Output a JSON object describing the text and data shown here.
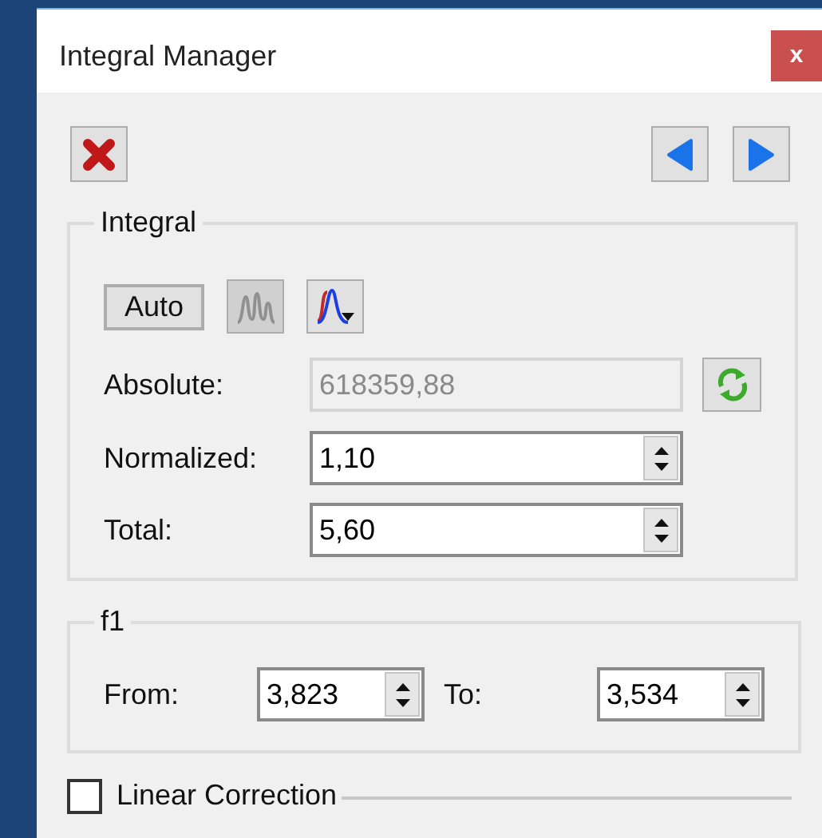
{
  "window": {
    "title": "Integral Manager",
    "close_label": "x"
  },
  "integral": {
    "legend": "Integral",
    "tools": [
      {
        "kind": "text",
        "label": "Auto",
        "disabled": false
      },
      {
        "kind": "peaks",
        "disabled": true
      },
      {
        "kind": "curve",
        "disabled": false
      }
    ],
    "absolute": {
      "label": "Absolute:",
      "value": "618359,88",
      "disabled": true
    },
    "normalized": {
      "label": "Normalized:",
      "value": "1,10"
    },
    "total": {
      "label": "Total:",
      "value": "5,60"
    }
  },
  "range": {
    "legend": "f1",
    "from_label": "From:",
    "from_value": "3,823",
    "to_label": "To:",
    "to_value": "3,534"
  },
  "linear_correction": {
    "label": "Linear Correction",
    "checked": false
  }
}
